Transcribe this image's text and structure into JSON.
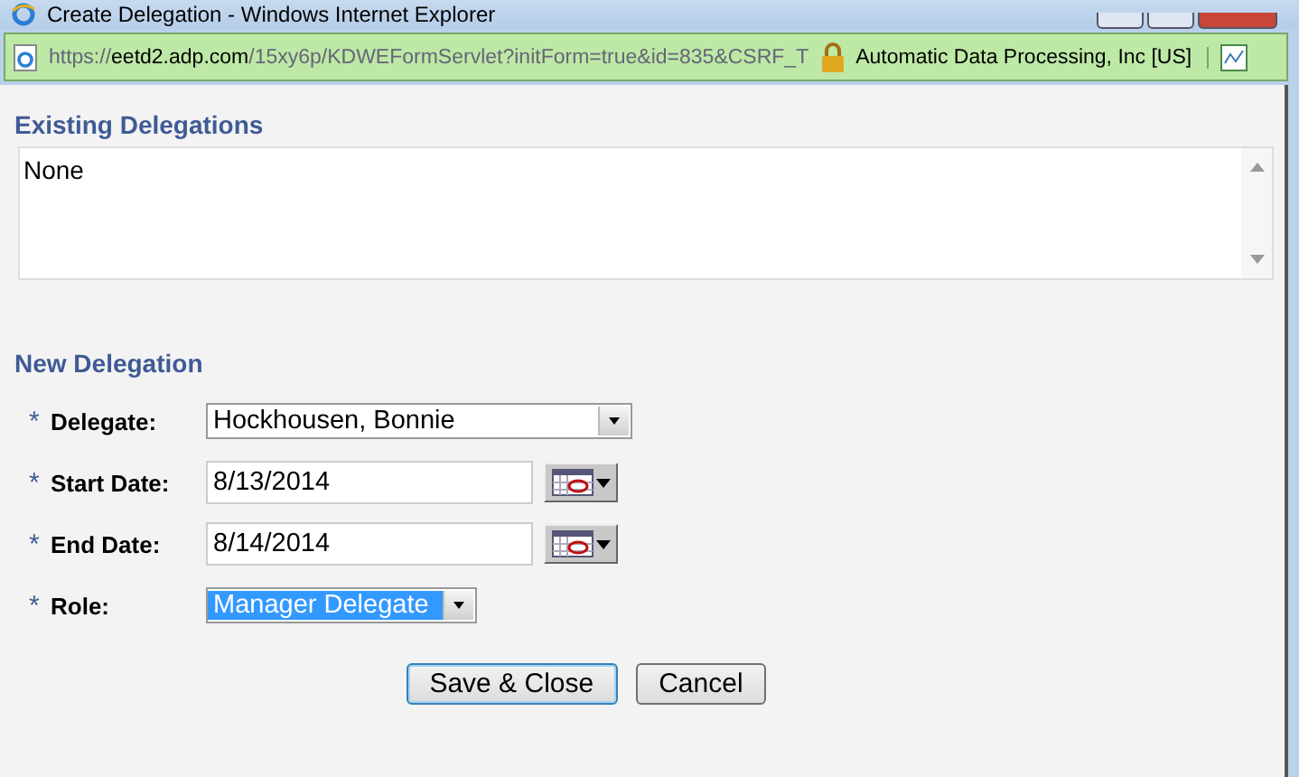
{
  "window": {
    "title": "Create Delegation - Windows Internet Explorer"
  },
  "address_bar": {
    "scheme": "https://",
    "host": "eetd2.adp.com",
    "path": "/15xy6p/KDWEFormServlet?initForm=true&id=835&CSRF_T",
    "certificate": "Automatic Data Processing, Inc [US]"
  },
  "existing": {
    "heading": "Existing Delegations",
    "text": "None"
  },
  "new_delegation": {
    "heading": "New Delegation",
    "fields": [
      {
        "kind": "select",
        "label": "Delegate:",
        "value": "Hockhousen, Bonnie",
        "required_mark": "*",
        "selected": false
      },
      {
        "kind": "date",
        "label": "Start Date:",
        "value": "8/13/2014",
        "required_mark": "*",
        "selected": false
      },
      {
        "kind": "date",
        "label": "End Date:",
        "value": "8/14/2014",
        "required_mark": "*",
        "selected": false
      },
      {
        "kind": "select",
        "label": "Role:",
        "value": "Manager Delegate",
        "required_mark": "*",
        "selected": true
      }
    ]
  },
  "buttons": [
    {
      "label": "Save & Close",
      "focused": true
    },
    {
      "label": "Cancel",
      "focused": false
    }
  ]
}
